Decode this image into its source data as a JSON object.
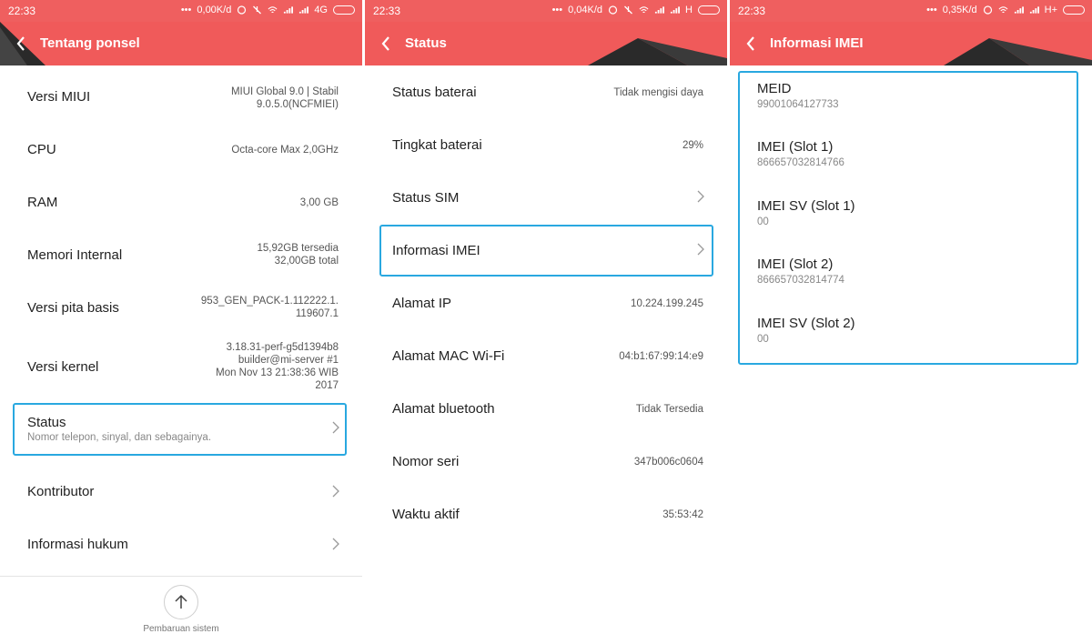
{
  "panels": [
    {
      "status_bar": {
        "time": "22:33",
        "speed": "0,00K/d",
        "network": "4G"
      },
      "title": "Tentang ponsel",
      "items": [
        {
          "label": "Versi MIUI",
          "value_lines": [
            "MIUI Global 9.0 | Stabil",
            "9.0.5.0(NCFMIEI)"
          ]
        },
        {
          "label": "CPU",
          "value_lines": [
            "Octa-core Max 2,0GHz"
          ]
        },
        {
          "label": "RAM",
          "value_lines": [
            "3,00 GB"
          ]
        },
        {
          "label": "Memori Internal",
          "value_lines": [
            "15,92GB tersedia",
            "32,00GB total"
          ]
        },
        {
          "label": "Versi pita basis",
          "value_lines": [
            "953_GEN_PACK-1.112222.1.",
            "119607.1"
          ]
        },
        {
          "label": "Versi kernel",
          "value_lines": [
            "3.18.31-perf-g5d1394b8",
            "builder@mi-server #1",
            "Mon Nov 13 21:38:36 WIB",
            "2017"
          ]
        },
        {
          "label": "Status",
          "subtitle": "Nomor telepon, sinyal, dan sebagainya."
        },
        {
          "label": "Kontributor"
        },
        {
          "label": "Informasi hukum"
        }
      ],
      "update_label": "Pembaruan sistem"
    },
    {
      "status_bar": {
        "time": "22:33",
        "speed": "0,04K/d",
        "network": "H"
      },
      "title": "Status",
      "items": [
        {
          "label": "Status baterai",
          "value": "Tidak mengisi daya"
        },
        {
          "label": "Tingkat baterai",
          "value": "29%"
        },
        {
          "label": "Status SIM"
        },
        {
          "label": "Informasi IMEI"
        },
        {
          "label": "Alamat IP",
          "value": "10.224.199.245"
        },
        {
          "label": "Alamat MAC Wi-Fi",
          "value": "04:b1:67:99:14:e9"
        },
        {
          "label": "Alamat bluetooth",
          "value": "Tidak Tersedia"
        },
        {
          "label": "Nomor seri",
          "value": "347b006c0604"
        },
        {
          "label": "Waktu aktif",
          "value": "35:53:42"
        }
      ]
    },
    {
      "status_bar": {
        "time": "22:33",
        "speed": "0,35K/d",
        "network": "H+"
      },
      "title": "Informasi IMEI",
      "items": [
        {
          "label": "MEID",
          "value": "99001064127733"
        },
        {
          "label": "IMEI (Slot 1)",
          "value": "866657032814766"
        },
        {
          "label": "IMEI SV (Slot 1)",
          "value": "00"
        },
        {
          "label": "IMEI (Slot 2)",
          "value": "866657032814774"
        },
        {
          "label": "IMEI SV (Slot 2)",
          "value": "00"
        }
      ]
    }
  ],
  "colors": {
    "header": "#f05a5a",
    "highlight": "#29a8e0"
  },
  "icons": [
    "back-chevron-icon",
    "chevron-right-icon",
    "arrow-up-icon",
    "wifi-icon",
    "signal-icon",
    "battery-icon",
    "alarm-icon",
    "mute-icon"
  ]
}
